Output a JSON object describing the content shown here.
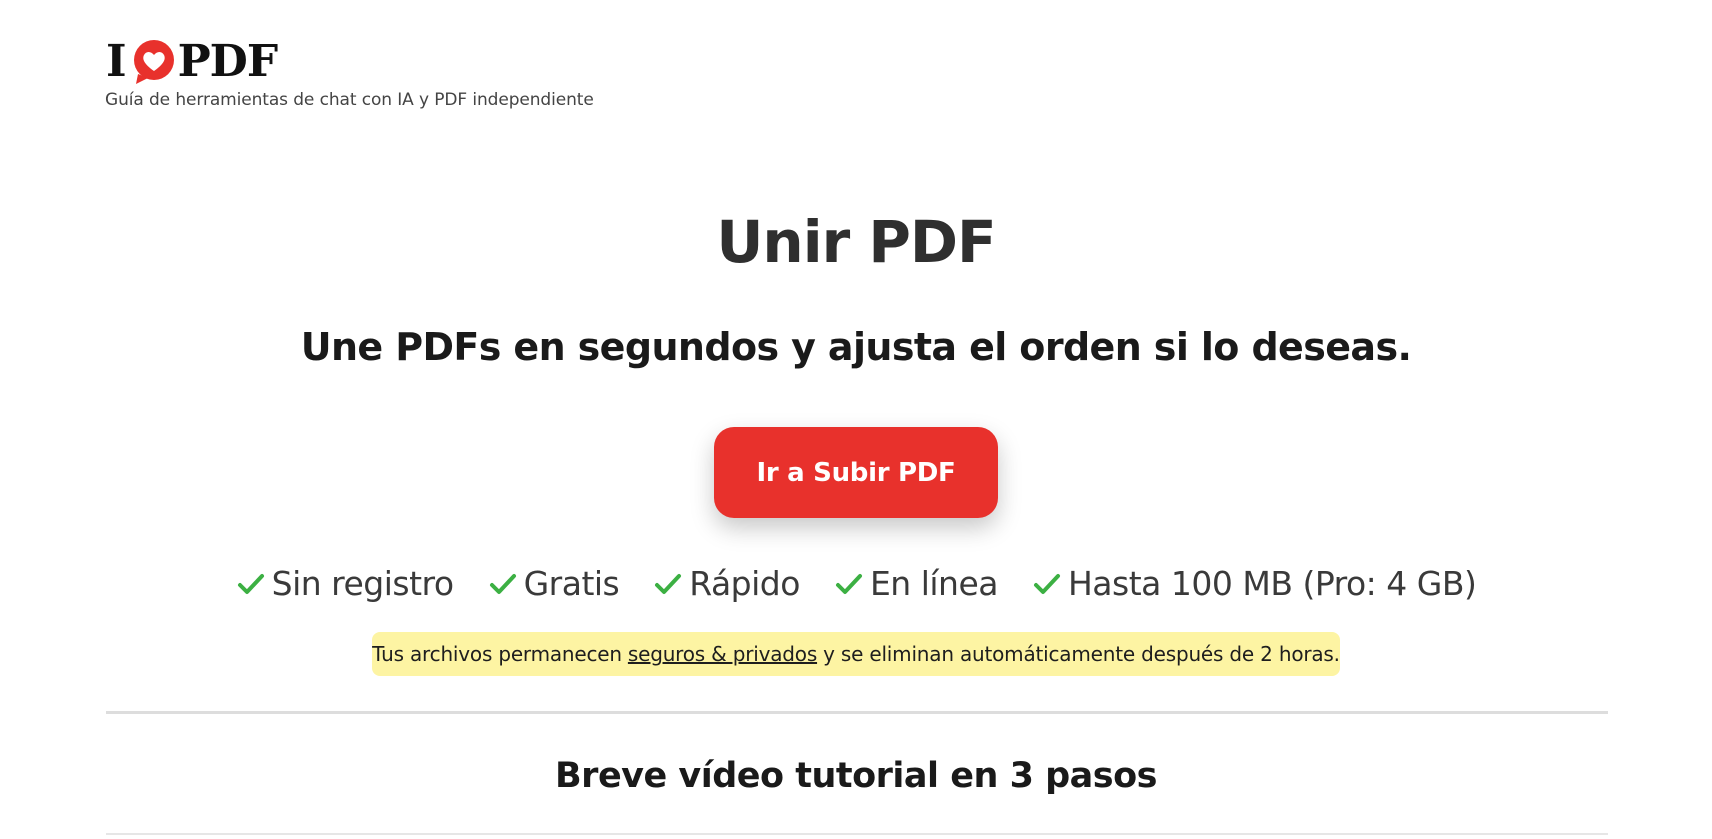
{
  "header": {
    "logo": {
      "letter_i": "I",
      "letters_pdf": "PDF",
      "heart_color": "#e8312c"
    },
    "tagline": "Guía de herramientas de chat con IA y PDF independiente"
  },
  "main": {
    "title": "Unir PDF",
    "subtitle": "Une PDFs en segundos y ajusta el orden si lo deseas.",
    "cta": {
      "label": "Ir a Subir PDF",
      "color": "#e8312c"
    },
    "features": [
      {
        "label": "Sin registro",
        "icon": "check-icon"
      },
      {
        "label": "Gratis",
        "icon": "check-icon"
      },
      {
        "label": "Rápido",
        "icon": "check-icon"
      },
      {
        "label": "En línea",
        "icon": "check-icon"
      },
      {
        "label": "Hasta 100 MB (Pro: 4 GB)",
        "icon": "check-icon"
      }
    ],
    "check_color": "#3cb043",
    "privacy": {
      "before": "Tus archivos permanecen",
      "link": "seguros & privados",
      "after": "y se eliminan automáticamente después de 2 horas.",
      "background": "#fdf4a3"
    }
  },
  "tutorial": {
    "title": "Breve vídeo tutorial en 3 pasos"
  }
}
